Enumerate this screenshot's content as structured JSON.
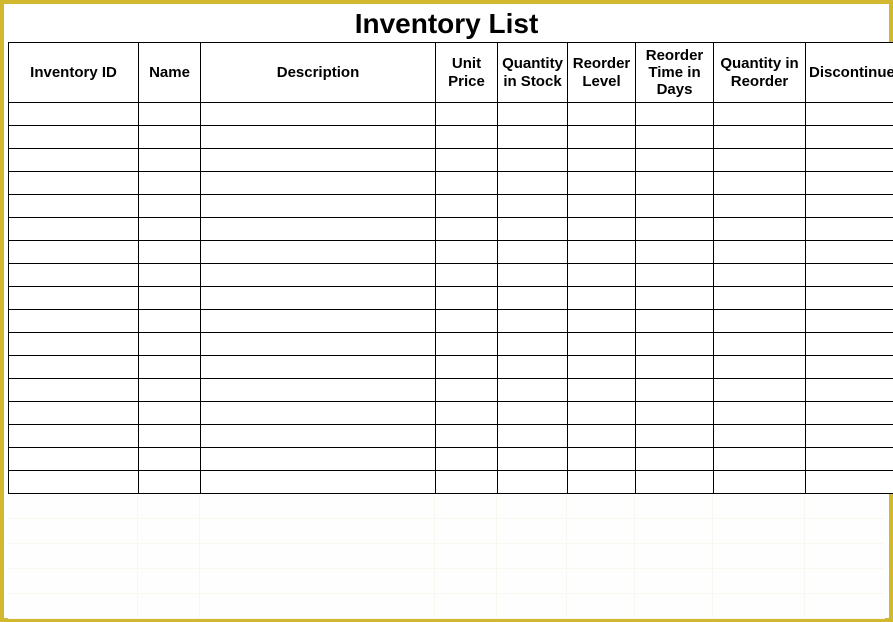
{
  "title": "Inventory List",
  "columns": [
    "Inventory ID",
    "Name",
    "Description",
    "Unit Price",
    "Quantity in Stock",
    "Reorder Level",
    "Reorder Time in Days",
    "Quantity in Reorder",
    "Discontinued?"
  ],
  "rows": [
    [
      "",
      "",
      "",
      "",
      "",
      "",
      "",
      "",
      ""
    ],
    [
      "",
      "",
      "",
      "",
      "",
      "",
      "",
      "",
      ""
    ],
    [
      "",
      "",
      "",
      "",
      "",
      "",
      "",
      "",
      ""
    ],
    [
      "",
      "",
      "",
      "",
      "",
      "",
      "",
      "",
      ""
    ],
    [
      "",
      "",
      "",
      "",
      "",
      "",
      "",
      "",
      ""
    ],
    [
      "",
      "",
      "",
      "",
      "",
      "",
      "",
      "",
      ""
    ],
    [
      "",
      "",
      "",
      "",
      "",
      "",
      "",
      "",
      ""
    ],
    [
      "",
      "",
      "",
      "",
      "",
      "",
      "",
      "",
      ""
    ],
    [
      "",
      "",
      "",
      "",
      "",
      "",
      "",
      "",
      ""
    ],
    [
      "",
      "",
      "",
      "",
      "",
      "",
      "",
      "",
      ""
    ],
    [
      "",
      "",
      "",
      "",
      "",
      "",
      "",
      "",
      ""
    ],
    [
      "",
      "",
      "",
      "",
      "",
      "",
      "",
      "",
      ""
    ],
    [
      "",
      "",
      "",
      "",
      "",
      "",
      "",
      "",
      ""
    ],
    [
      "",
      "",
      "",
      "",
      "",
      "",
      "",
      "",
      ""
    ],
    [
      "",
      "",
      "",
      "",
      "",
      "",
      "",
      "",
      ""
    ],
    [
      "",
      "",
      "",
      "",
      "",
      "",
      "",
      "",
      ""
    ],
    [
      "",
      "",
      "",
      "",
      "",
      "",
      "",
      "",
      ""
    ]
  ],
  "spacer_rows": 5
}
